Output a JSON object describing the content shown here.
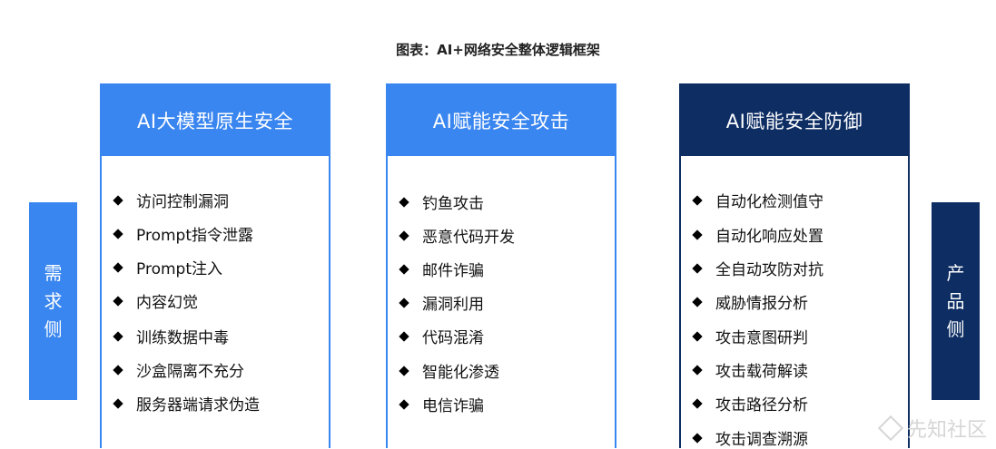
{
  "title": "图表：AI+网络安全整体逻辑框架",
  "colors": {
    "light_blue": "#3a86f0",
    "navy": "#0d2d63",
    "side_left": "#3a86f0",
    "side_right": "#0d2d63"
  },
  "side_left": {
    "chars": [
      "需",
      "求",
      "侧"
    ]
  },
  "side_right": {
    "chars": [
      "产",
      "品",
      "侧"
    ]
  },
  "columns": [
    {
      "header": "AI大模型原生安全",
      "items": [
        "访问控制漏洞",
        "Prompt指令泄露",
        "Prompt注入",
        "内容幻觉",
        "训练数据中毒",
        "沙盒隔离不充分",
        "服务器端请求伪造"
      ]
    },
    {
      "header": "AI赋能安全攻击",
      "items": [
        "钓鱼攻击",
        "恶意代码开发",
        "邮件诈骗",
        "漏洞利用",
        "代码混淆",
        "智能化渗透",
        "电信诈骗"
      ]
    },
    {
      "header": "AI赋能安全防御",
      "items": [
        "自动化检测值守",
        "自动化响应处置",
        "全自动攻防对抗",
        "威胁情报分析",
        "攻击意图研判",
        "攻击载荷解读",
        "攻击路径分析",
        "攻击调查溯源"
      ]
    }
  ],
  "watermark": "先知社区"
}
